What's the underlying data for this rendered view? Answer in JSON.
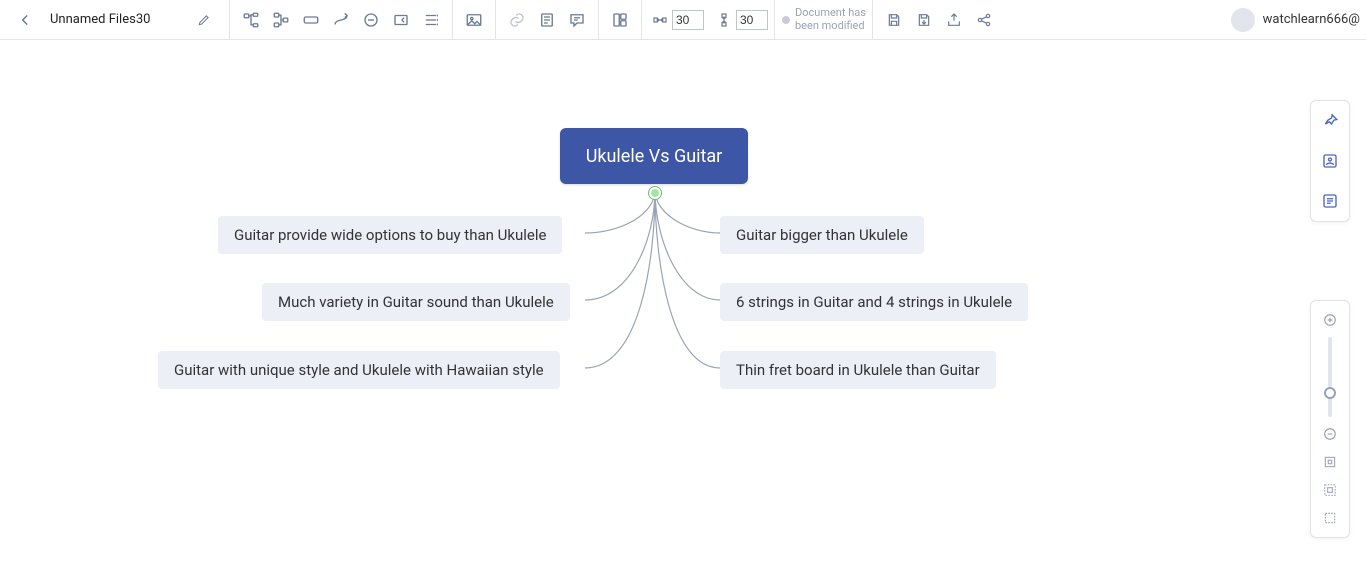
{
  "file": {
    "name": "Unnamed Files30"
  },
  "status": {
    "line1": "Document has",
    "line2": "been modified"
  },
  "spacing": {
    "h": "30",
    "v": "30"
  },
  "user": {
    "name": "watchlearn666@"
  },
  "mindmap": {
    "root": "Ukulele Vs Guitar",
    "left": [
      "Guitar provide wide options to buy than Ukulele",
      "Much variety in Guitar sound than Ukulele",
      "Guitar with unique style and Ukulele with Hawaiian style"
    ],
    "right": [
      "Guitar bigger than Ukulele",
      "6 strings in Guitar and 4 strings in Ukulele",
      "Thin fret board in Ukulele than Guitar"
    ]
  }
}
